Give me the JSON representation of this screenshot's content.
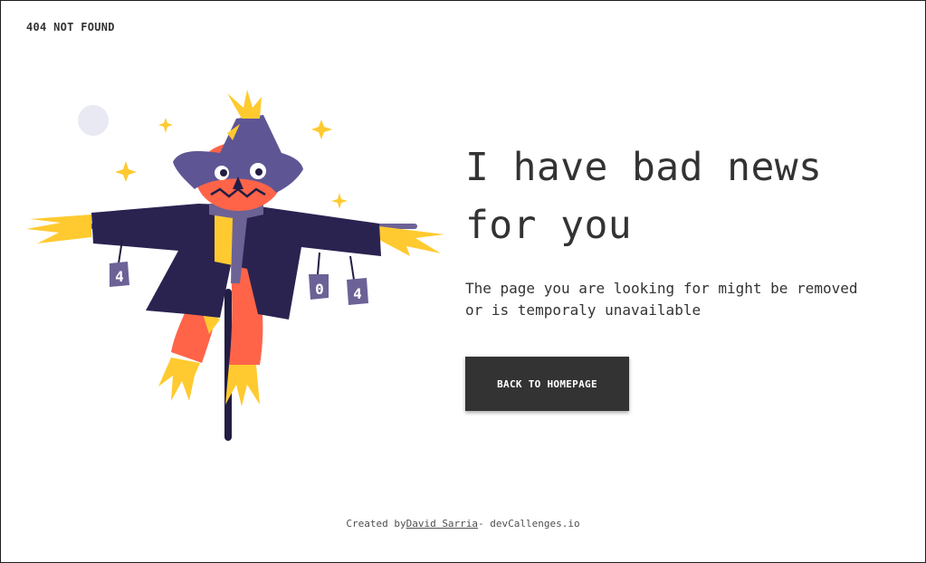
{
  "header": {
    "brand": "404 NOT FOUND"
  },
  "illustration": {
    "label": "scarecrow",
    "cans": [
      "4",
      "0",
      "4"
    ],
    "colors": {
      "hat": "#5e5694",
      "coat": "#2a2350",
      "pumpkin": "#ff6449",
      "straw": "#ffca30",
      "scarf": "#6c6296",
      "moon": "#e8e9f3",
      "pole": "#231d43"
    }
  },
  "main": {
    "headline_line1": "I have bad news",
    "headline_line2": "for you",
    "description_line1": "The page you are looking for might be removed",
    "description_line2": "or is temporaly unavailable",
    "cta_label": "BACK TO HOMEPAGE"
  },
  "footer": {
    "prefix": "Created by",
    "author": "David Sarria",
    "suffix": "- devCallenges.io"
  }
}
